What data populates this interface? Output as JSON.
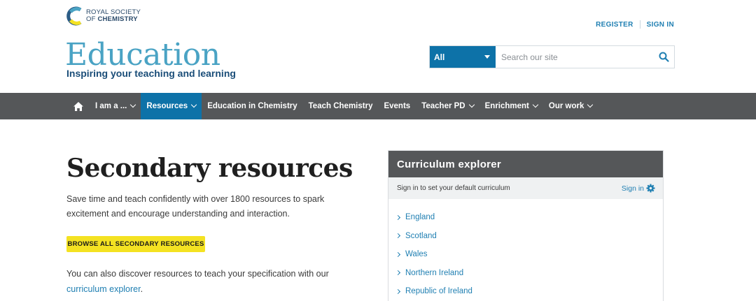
{
  "logo": {
    "line1": "ROYAL SOCIETY",
    "line2_prefix": "OF ",
    "line2_bold": "CHEMISTRY"
  },
  "top_links": {
    "register": "REGISTER",
    "sign_in": "SIGN IN"
  },
  "brand": {
    "title": "Education",
    "tagline": "Inspiring your teaching and learning"
  },
  "search": {
    "scope": "All",
    "placeholder": "Search our site",
    "icon": "search-icon"
  },
  "nav": {
    "home_icon": "home-icon",
    "items": [
      {
        "label": "I am a ...",
        "dropdown": true
      },
      {
        "label": "Resources",
        "dropdown": true,
        "active": true
      },
      {
        "label": "Education in Chemistry",
        "dropdown": false
      },
      {
        "label": "Teach Chemistry",
        "dropdown": false
      },
      {
        "label": "Events",
        "dropdown": false
      },
      {
        "label": "Teacher PD",
        "dropdown": true
      },
      {
        "label": "Enrichment",
        "dropdown": true
      },
      {
        "label": "Our work",
        "dropdown": true
      }
    ]
  },
  "main": {
    "title": "Secondary resources",
    "intro": "Save time and teach confidently with over 1800 resources to spark excitement and encourage understanding and interaction.",
    "cta": "BROWSE ALL SECONDARY RESOURCES",
    "also_text": "You can also discover resources to teach your specification with our ",
    "also_link": "curriculum explorer",
    "also_end": "."
  },
  "curriculum": {
    "title": "Curriculum explorer",
    "signin_prompt": "Sign in to set your default curriculum",
    "signin_link": "Sign in",
    "items": [
      "England",
      "Scotland",
      "Wales",
      "Northern Ireland",
      "Republic of Ireland"
    ]
  },
  "colors": {
    "accent_blue": "#0d72a8",
    "nav_grey": "#555759",
    "cta_yellow": "#f4e222",
    "brand_teal": "#4aa3c4"
  }
}
